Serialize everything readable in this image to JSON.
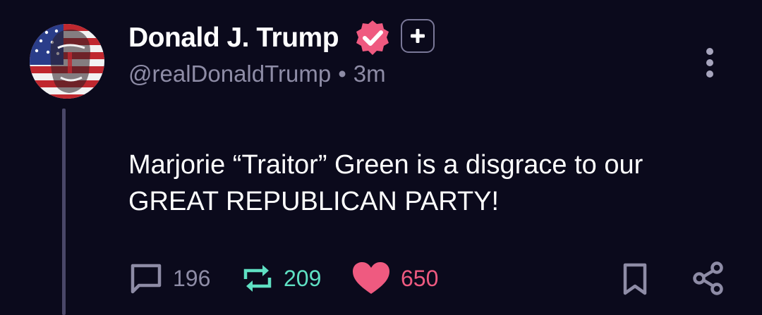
{
  "post": {
    "display_name": "Donald J. Trump",
    "handle": "@realDonaldTrump",
    "separator": "•",
    "time": "3m",
    "text": "Marjorie “Traitor” Green is a disgrace to our GREAT REPUBLICAN PARTY!"
  },
  "actions": {
    "replies": "196",
    "reposts": "209",
    "likes": "650"
  },
  "colors": {
    "background": "#0b0a1c",
    "verified": "#ef5a80",
    "repost": "#5fe0c3",
    "like": "#ef5a80",
    "muted": "#8e8ca6"
  },
  "icons": [
    "verified-badge-icon",
    "plus-icon",
    "more-vertical-icon",
    "reply-icon",
    "repost-icon",
    "heart-icon",
    "bookmark-icon",
    "share-icon"
  ]
}
